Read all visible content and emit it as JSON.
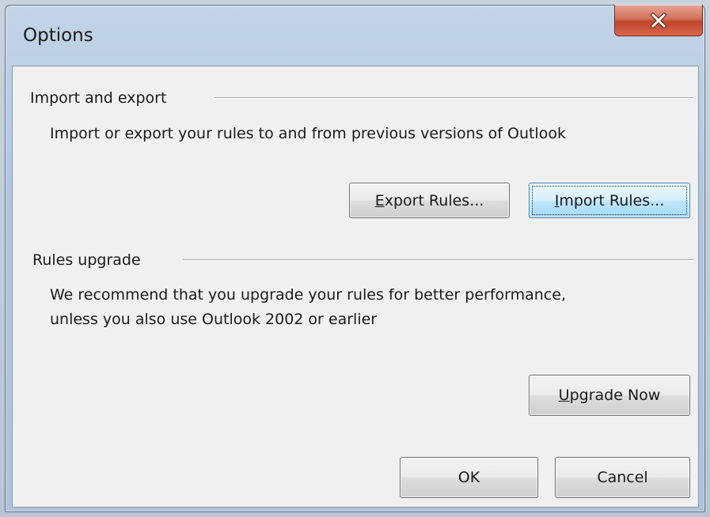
{
  "window": {
    "title": "Options",
    "close_glyph": "X"
  },
  "import_export": {
    "heading": "Import and export",
    "description": "Import or export your rules to and from previous versions of Outlook",
    "export_button": {
      "accel": "E",
      "rest": "xport Rules..."
    },
    "import_button": {
      "accel": "I",
      "rest": "mport Rules..."
    }
  },
  "rules_upgrade": {
    "heading": "Rules upgrade",
    "description_line1": "We recommend that you upgrade your rules for better performance,",
    "description_line2": "unless you also use Outlook 2002 or earlier",
    "upgrade_button": {
      "accel": "U",
      "rest": "pgrade Now"
    }
  },
  "footer": {
    "ok_label": "OK",
    "cancel_label": "Cancel"
  },
  "colors": {
    "close_button": "#c0452b",
    "focused_button_border": "#3c7fb1",
    "dialog_face": "#f0f0f0"
  },
  "icons": {
    "close": "close-icon"
  }
}
